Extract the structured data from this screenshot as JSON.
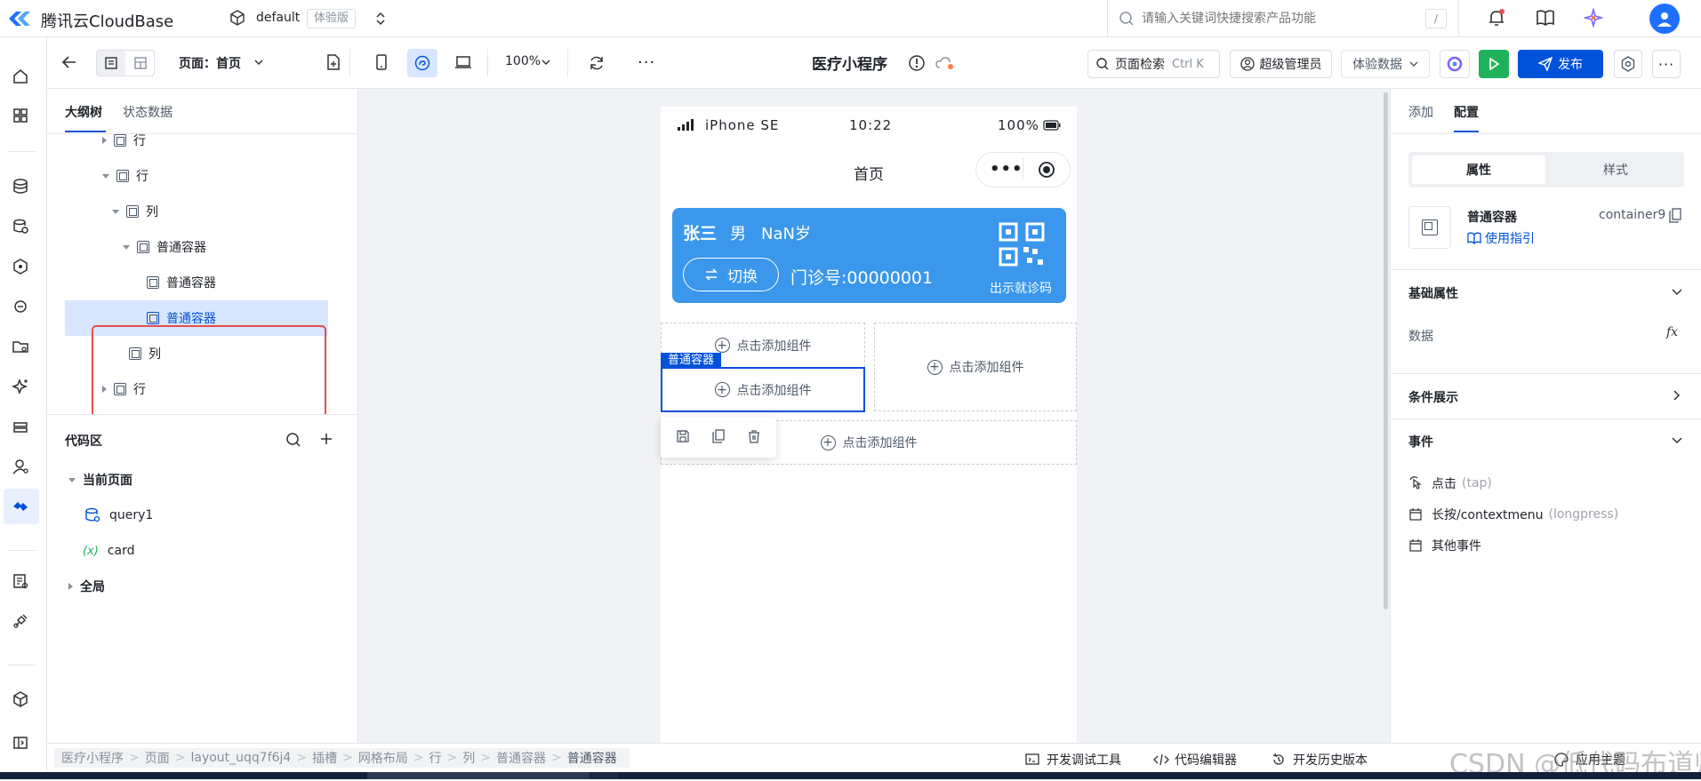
{
  "app": {
    "brand": "腾讯云CloudBase",
    "env_name": "default",
    "env_badge": "体验版",
    "search_placeholder": "请输入关键词快捷搜索产品功能",
    "search_shortcut": "/"
  },
  "toolbar": {
    "page_label": "页面：首页",
    "zoom": "100%",
    "app_title": "医疗小程序",
    "page_search": "页面检索",
    "page_search_hint": "Ctrl K",
    "role": "超级管理员",
    "data_mode": "体验数据",
    "publish": "发布"
  },
  "outline": {
    "tabs": [
      "大纲树",
      "状态数据"
    ],
    "tree": [
      {
        "label": "行"
      },
      {
        "label": "行"
      },
      {
        "label": "列"
      },
      {
        "label": "普通容器"
      },
      {
        "label": "普通容器"
      },
      {
        "label": "普通容器"
      },
      {
        "label": "列"
      },
      {
        "label": "行"
      }
    ],
    "code_title": "代码区",
    "current_page": "当前页面",
    "query": "query1",
    "card_prefix": "(x)",
    "card": "card",
    "global": "全局"
  },
  "phone": {
    "carrier": "iPhone SE",
    "time": "10:22",
    "battery": "100%",
    "nav_title": "首页",
    "card": {
      "name": "张三",
      "gender": "男",
      "age": "NaN岁",
      "switch": "切换",
      "clinic_no": "门诊号:00000001",
      "qr_label": "出示就诊码"
    },
    "add_component": "点击添加组件",
    "selected_tag": "普通容器"
  },
  "right": {
    "tabs": [
      "添加",
      "配置"
    ],
    "subtabs": [
      "属性",
      "样式"
    ],
    "component_name": "普通容器",
    "component_id": "container9",
    "guide": "使用指引",
    "basic_props": "基础属性",
    "data_label": "数据",
    "fx": "fx",
    "condition": "条件展示",
    "events_title": "事件",
    "events": [
      {
        "name": "点击",
        "code": "(tap)"
      },
      {
        "name": "长按/contextmenu",
        "code": "(longpress)"
      },
      {
        "name": "其他事件",
        "code": ""
      }
    ]
  },
  "breadcrumb": [
    "医疗小程序",
    "页面",
    "layout_uqq7f6j4",
    "插槽",
    "网格布局",
    "行",
    "列",
    "普通容器",
    "普通容器"
  ],
  "bottom_tools": [
    "开发调试工具",
    "代码编辑器",
    "开发历史版本",
    "应用主题"
  ],
  "watermark": "CSDN @低代码布道师",
  "colors": {
    "accent": "#0052d9",
    "card_bg": "#3a97ec",
    "highlight": "#d9e6ff",
    "select_red": "#e34d4d",
    "run_green": "#1fb25a"
  }
}
